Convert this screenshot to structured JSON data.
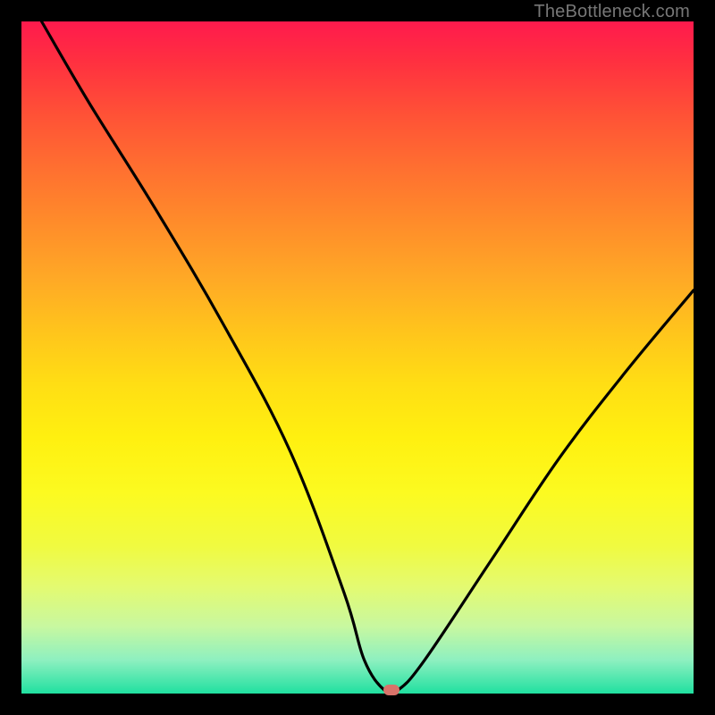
{
  "attribution": "TheBottleneck.com",
  "chart_data": {
    "type": "line",
    "title": "",
    "xlabel": "",
    "ylabel": "",
    "xlim": [
      0,
      100
    ],
    "ylim": [
      0,
      100
    ],
    "background_gradient": {
      "top_color": "#ff1a4d",
      "mid_color": "#ffde14",
      "bottom_color": "#20e0a0"
    },
    "series": [
      {
        "name": "bottleneck-curve",
        "x": [
          3,
          10,
          20,
          30,
          40,
          48,
          51,
          54,
          56,
          60,
          70,
          80,
          90,
          100
        ],
        "y": [
          100,
          88,
          72,
          55,
          36,
          15,
          5,
          0.5,
          0.5,
          5,
          20,
          35,
          48,
          60
        ]
      }
    ],
    "annotations": [
      {
        "name": "minimum-marker",
        "x": 55,
        "y": 0.5,
        "shape": "rounded-rect",
        "color": "#d9736a"
      }
    ]
  }
}
